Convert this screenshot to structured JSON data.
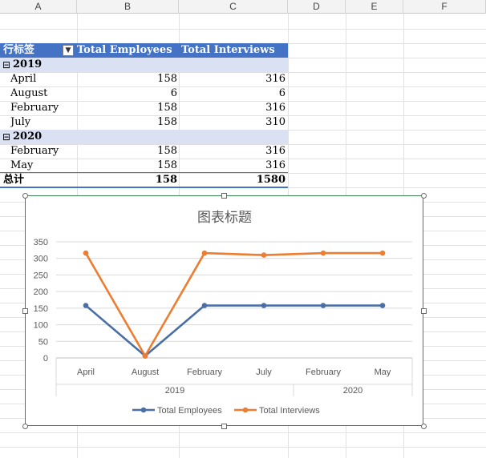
{
  "columns": [
    "A",
    "B",
    "C",
    "D",
    "E",
    "F"
  ],
  "pivot": {
    "header": {
      "row_labels": "行标签",
      "col1": "Total Employees",
      "col2": "Total Interviews",
      "filter_icon": "dropdown-arrow"
    },
    "groups": [
      {
        "toggle": "⊟",
        "year": "2019",
        "rows": [
          {
            "label": "April",
            "employees": "158",
            "interviews": "316"
          },
          {
            "label": "August",
            "employees": "6",
            "interviews": "6"
          },
          {
            "label": "February",
            "employees": "158",
            "interviews": "316"
          },
          {
            "label": "July",
            "employees": "158",
            "interviews": "310"
          }
        ]
      },
      {
        "toggle": "⊟",
        "year": "2020",
        "rows": [
          {
            "label": "February",
            "employees": "158",
            "interviews": "316"
          },
          {
            "label": "May",
            "employees": "158",
            "interviews": "316"
          }
        ]
      }
    ],
    "total": {
      "label": "总计",
      "employees": "158",
      "interviews": "1580"
    }
  },
  "chart_data": {
    "type": "line",
    "title": "图表标题",
    "categories": [
      "April",
      "August",
      "February",
      "July",
      "February",
      "May"
    ],
    "category_groups": [
      {
        "label": "2019",
        "count": 4
      },
      {
        "label": "2020",
        "count": 2
      }
    ],
    "yticks": [
      0,
      50,
      100,
      150,
      200,
      250,
      300,
      350
    ],
    "ylim": [
      0,
      350
    ],
    "grid": true,
    "legend_position": "bottom",
    "series": [
      {
        "name": "Total Employees",
        "values": [
          158,
          6,
          158,
          158,
          158,
          158
        ],
        "color": "#4a6fa5"
      },
      {
        "name": "Total Interviews",
        "values": [
          316,
          6,
          316,
          310,
          316,
          316
        ],
        "color": "#ed7d31"
      }
    ]
  }
}
